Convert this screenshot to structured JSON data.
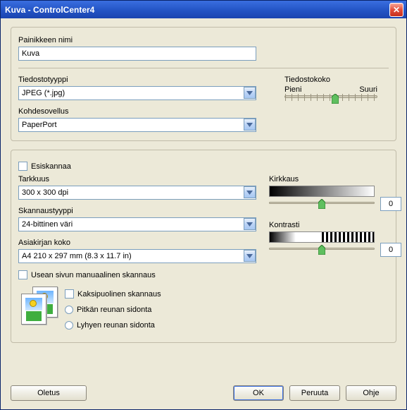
{
  "window": {
    "title": "Kuva - ControlCenter4"
  },
  "group1": {
    "button_name_label": "Painikkeen nimi",
    "button_name_value": "Kuva",
    "filetype_label": "Tiedostotyyppi",
    "filetype_value": "JPEG (*.jpg)",
    "targetapp_label": "Kohdesovellus",
    "targetapp_value": "PaperPort",
    "filesize_label": "Tiedostokoko",
    "filesize_small": "Pieni",
    "filesize_large": "Suuri"
  },
  "group2": {
    "prescan_label": "Esiskannaa",
    "resolution_label": "Tarkkuus",
    "resolution_value": "300 x 300 dpi",
    "scantype_label": "Skannaustyyppi",
    "scantype_value": "24-bittinen väri",
    "docsize_label": "Asiakirjan koko",
    "docsize_value": "A4 210 x 297 mm (8.3 x 11.7 in)",
    "multipage_label": "Usean sivun manuaalinen skannaus",
    "duplex_label": "Kaksipuolinen skannaus",
    "longedge_label": "Pitkän reunan sidonta",
    "shortedge_label": "Lyhyen reunan sidonta",
    "brightness_label": "Kirkkaus",
    "brightness_value": "0",
    "contrast_label": "Kontrasti",
    "contrast_value": "0"
  },
  "buttons": {
    "default": "Oletus",
    "ok": "OK",
    "cancel": "Peruuta",
    "help": "Ohje"
  }
}
